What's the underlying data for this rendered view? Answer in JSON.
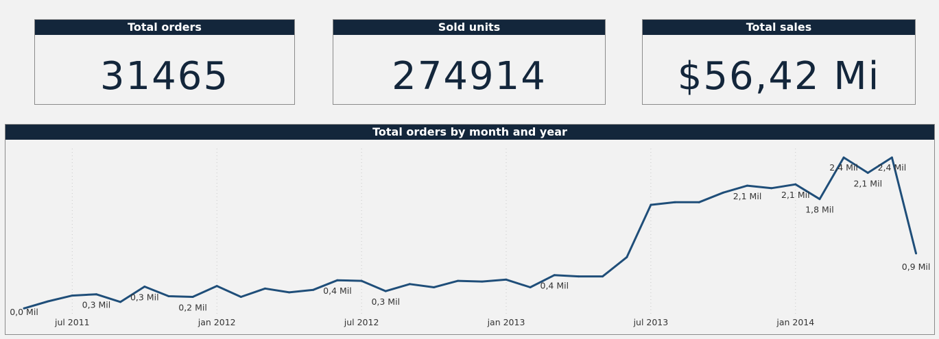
{
  "kpis": [
    {
      "title": "Total orders",
      "value": "31465"
    },
    {
      "title": "Sold units",
      "value": "274914"
    },
    {
      "title": "Total sales",
      "value": "$56,42 Mi"
    }
  ],
  "chart_data": {
    "type": "line",
    "title": "Total orders by month and year",
    "color": "#1f4e79",
    "grid": "vertical dotted at ticks",
    "x_ticks": [
      "jul 2011",
      "jan 2012",
      "jul 2012",
      "jan 2013",
      "jul 2013",
      "jan 2014"
    ],
    "x": [
      "2011-05",
      "2011-06",
      "2011-07",
      "2011-08",
      "2011-09",
      "2011-10",
      "2011-11",
      "2011-12",
      "2012-01",
      "2012-02",
      "2012-03",
      "2012-04",
      "2012-05",
      "2012-06",
      "2012-07",
      "2012-08",
      "2012-09",
      "2012-10",
      "2012-11",
      "2012-12",
      "2013-01",
      "2013-02",
      "2013-03",
      "2013-04",
      "2013-05",
      "2013-06",
      "2013-07",
      "2013-08",
      "2013-09",
      "2013-10",
      "2013-11",
      "2013-12",
      "2014-01",
      "2014-02",
      "2014-03",
      "2014-04",
      "2014-05",
      "2014-06"
    ],
    "values": [
      0.04,
      0.15,
      0.24,
      0.26,
      0.14,
      0.38,
      0.23,
      0.22,
      0.39,
      0.22,
      0.35,
      0.29,
      0.33,
      0.48,
      0.47,
      0.31,
      0.42,
      0.37,
      0.47,
      0.46,
      0.49,
      0.37,
      0.56,
      0.54,
      0.54,
      0.84,
      1.66,
      1.7,
      1.7,
      1.85,
      1.96,
      1.92,
      1.98,
      1.75,
      2.4,
      2.16,
      2.4,
      0.9
    ],
    "labels": [
      {
        "index": 0,
        "text": "0,0 Mil"
      },
      {
        "index": 3,
        "text": "0,3 Mil"
      },
      {
        "index": 5,
        "text": "0,3 Mil"
      },
      {
        "index": 7,
        "text": "0,2 Mil"
      },
      {
        "index": 13,
        "text": "0,4 Mil"
      },
      {
        "index": 15,
        "text": "0,3 Mil"
      },
      {
        "index": 22,
        "text": "0,4 Mil"
      },
      {
        "index": 30,
        "text": "2,1 Mil"
      },
      {
        "index": 32,
        "text": "2,1 Mil"
      },
      {
        "index": 33,
        "text": "1,8 Mil"
      },
      {
        "index": 34,
        "text": "2,4 Mil"
      },
      {
        "index": 35,
        "text": "2,1 Mil"
      },
      {
        "index": 36,
        "text": "2,4 Mil"
      },
      {
        "index": 37,
        "text": "0,9 Mil"
      }
    ]
  }
}
